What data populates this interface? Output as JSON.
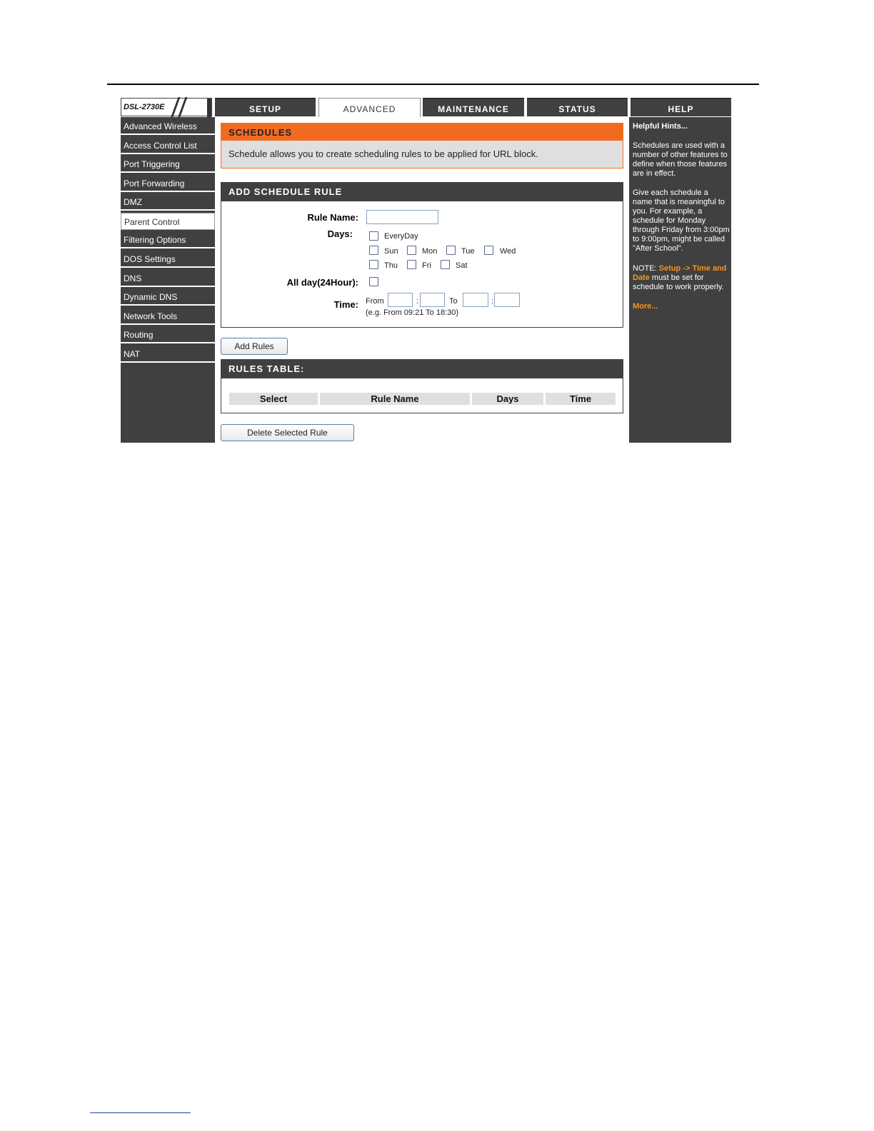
{
  "header": {
    "model": "DSL-2730E",
    "tabs": [
      {
        "label": "SETUP"
      },
      {
        "label": "ADVANCED"
      },
      {
        "label": "MAINTENANCE"
      },
      {
        "label": "STATUS"
      },
      {
        "label": "HELP"
      }
    ]
  },
  "sidebar": {
    "items": [
      {
        "label": "Advanced Wireless"
      },
      {
        "label": "Access Control List"
      },
      {
        "label": "Port Triggering"
      },
      {
        "label": "Port Forwarding"
      },
      {
        "label": "DMZ"
      },
      {
        "label": "Parent Control"
      },
      {
        "label": "Filtering Options"
      },
      {
        "label": "DOS Settings"
      },
      {
        "label": "DNS"
      },
      {
        "label": "Dynamic DNS"
      },
      {
        "label": "Network Tools"
      },
      {
        "label": "Routing"
      },
      {
        "label": "NAT"
      }
    ]
  },
  "schedules": {
    "title": "SCHEDULES",
    "description": "Schedule allows you to create scheduling rules to be applied for URL block."
  },
  "add_rule": {
    "title": "ADD SCHEDULE RULE",
    "rule_name_label": "Rule Name:",
    "rule_name_value": "",
    "days_label": "Days:",
    "everyday": "EveryDay",
    "days": {
      "sun": "Sun",
      "mon": "Mon",
      "tue": "Tue",
      "wed": "Wed",
      "thu": "Thu",
      "fri": "Fri",
      "sat": "Sat"
    },
    "allday_label": "All day(24Hour):",
    "time_label": "Time:",
    "from": "From",
    "to": "To",
    "colon": ":",
    "example": "(e.g. From 09:21 To 18:30)",
    "add_button": "Add Rules"
  },
  "rules_table": {
    "title": "RULES TABLE:",
    "columns": [
      "Select",
      "Rule Name",
      "Days",
      "Time"
    ],
    "delete_button": "Delete Selected Rule"
  },
  "hints": {
    "title": "Helpful Hints...",
    "p1": "Schedules are used with a number of other features to define when those features are in effect.",
    "p2": "Give each schedule a name that is meaningful to you. For example, a schedule for Monday through Friday from 3:00pm to 9:00pm, might be called \"After School\".",
    "note_prefix": "NOTE: ",
    "note_link": "Setup -> Time and Date",
    "note_suffix": " must be set for schedule to work properly.",
    "more": "More..."
  },
  "colors": {
    "dark": "#404040",
    "accent": "#f26a21",
    "hint_link": "#f7941d"
  }
}
